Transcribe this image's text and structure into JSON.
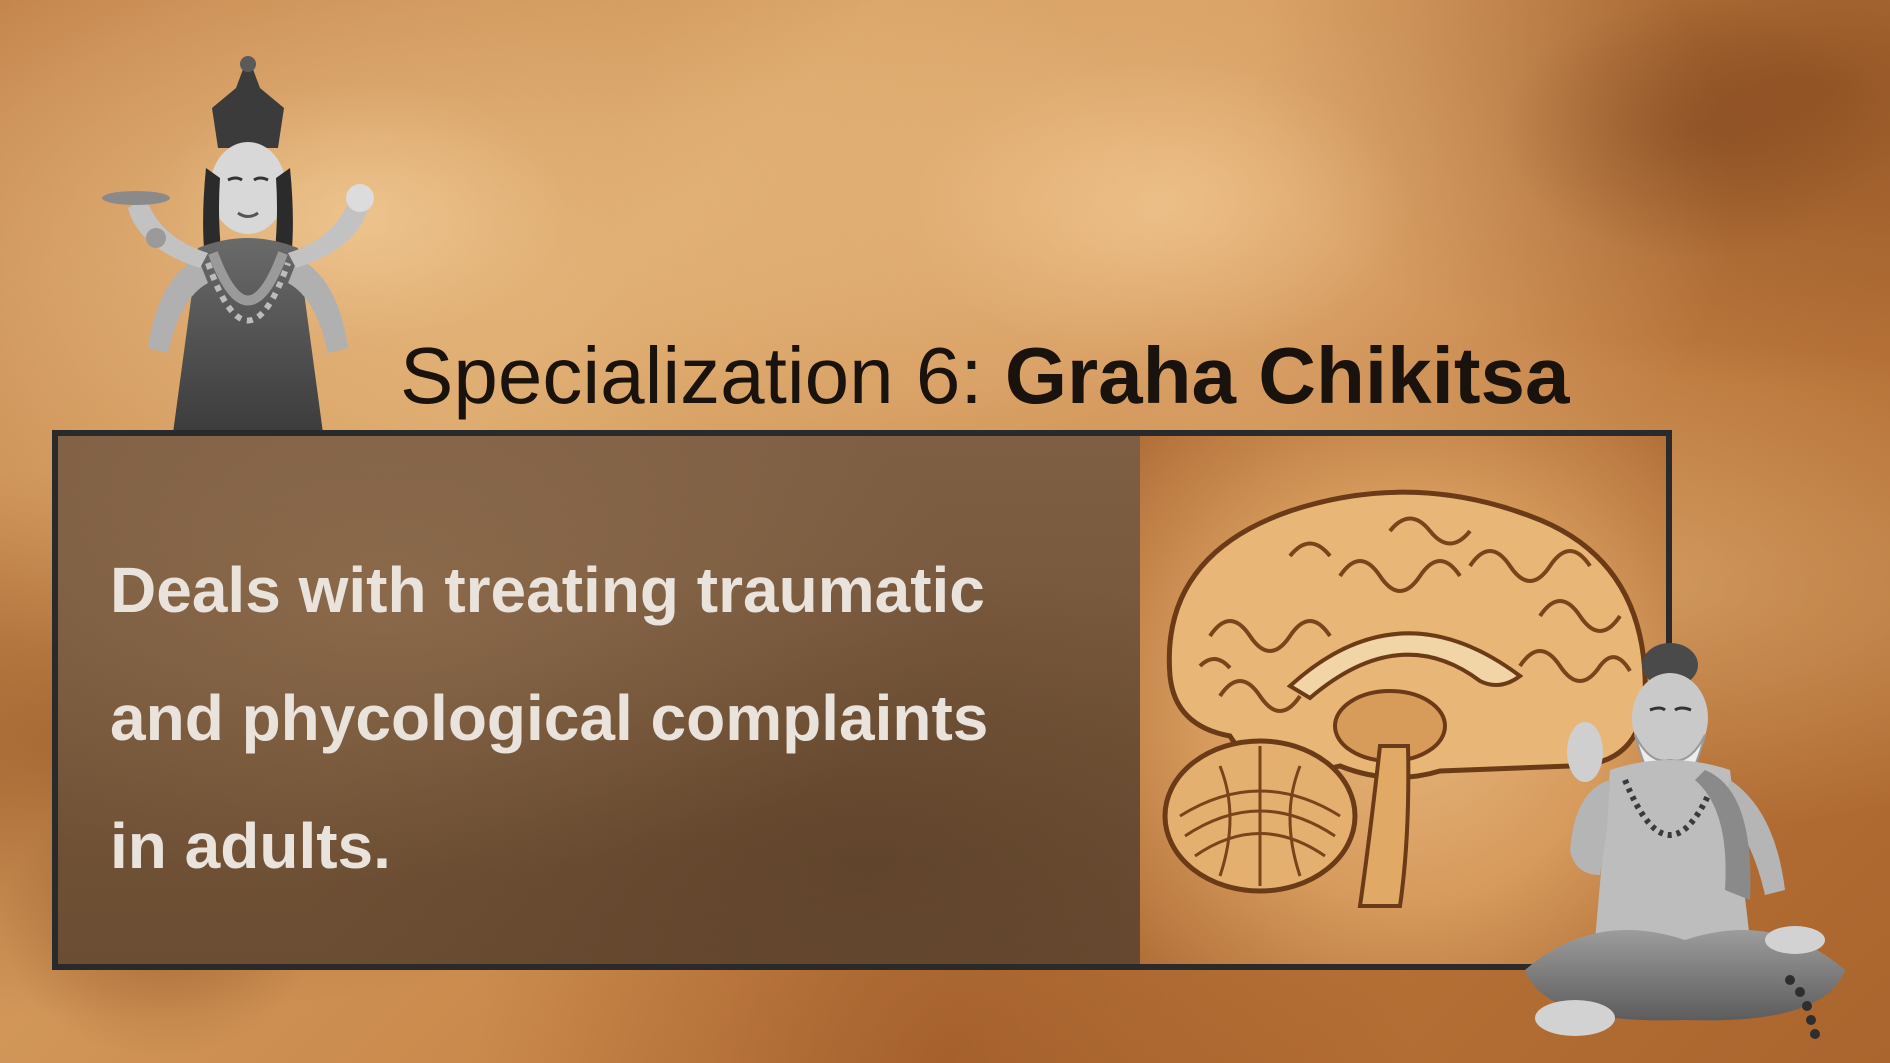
{
  "slide": {
    "title_prefix": "Specialization 6:",
    "title_emphasis": "Graha Chikitsa",
    "body_lines": [
      "Deals with treating traumatic",
      "and phycological complaints",
      "in adults."
    ]
  },
  "images": {
    "deity_figure": "deity-illustration",
    "brain": "brain-sagittal-illustration",
    "sage_figure": "seated-sage-illustration"
  },
  "colors": {
    "background": "#c9874a",
    "panel": "#7a5a3f",
    "panel_border": "#2a2a2a",
    "title_text": "#1a120c",
    "body_text": "#e9e3dc"
  }
}
